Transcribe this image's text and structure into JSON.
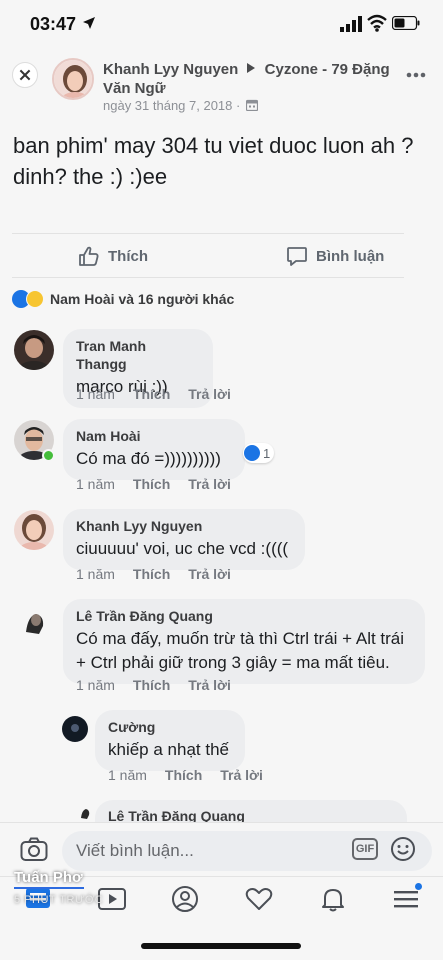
{
  "status": {
    "time": "03:47"
  },
  "post": {
    "author": "Khanh Lyy Nguyen",
    "target": "Cyzone - 79 Đặng Văn Ngữ",
    "date": "ngày 31 tháng 7, 2018 ·",
    "text": "ban phim' may 304 tu viet duoc luon ah ?\ndinh? the :) :)ee"
  },
  "actions": {
    "like_label": "Thích",
    "comment_label": "Bình luận"
  },
  "reactions": {
    "summary": "Nam Hoài và 16 người khác"
  },
  "comments": [
    {
      "author": "Tran Manh Thangg",
      "text": "marco rùi :))",
      "time": "1 năm",
      "like": "Thích",
      "reply": "Trả lời"
    },
    {
      "author": "Nam Hoài",
      "text": "Có ma đó =))))))))))",
      "time": "1 năm",
      "like": "Thích",
      "reply": "Trả lời",
      "likes": "1"
    },
    {
      "author": "Khanh Lyy Nguyen",
      "text": "ciuuuuu' voi, uc che vcd :((((",
      "time": "1 năm",
      "like": "Thích",
      "reply": "Trả lời"
    },
    {
      "author": "Lê Trần Đăng Quang",
      "text": "Có ma đấy, muốn trừ tà thì Ctrl trái + Alt trái + Ctrl phải giữ trong 3 giây = ma mất tiêu.",
      "time": "1 năm",
      "like": "Thích",
      "reply": "Trả lời"
    },
    {
      "author": "Cường",
      "text": "khiếp a nhạt thế",
      "time": "1 năm",
      "like": "Thích",
      "reply": "Trả lời"
    },
    {
      "author": "Lê Trần Đăng Quang"
    }
  ],
  "composer": {
    "placeholder": "Viết bình luận...",
    "gif_label": "GIF"
  },
  "overlay": {
    "name": "Tuấn Phơ",
    "time": "5 PHÚT TRƯỚC"
  },
  "colors": {
    "accent": "#1b74e4",
    "bubble": "#ecedef",
    "background": "#f6f6f6"
  },
  "icons": {
    "close": "close-icon",
    "more": "more-dots-icon",
    "like": "thumbs-up-icon",
    "comment": "comment-bubble-icon",
    "camera": "camera-icon",
    "emoji": "smiley-icon"
  }
}
